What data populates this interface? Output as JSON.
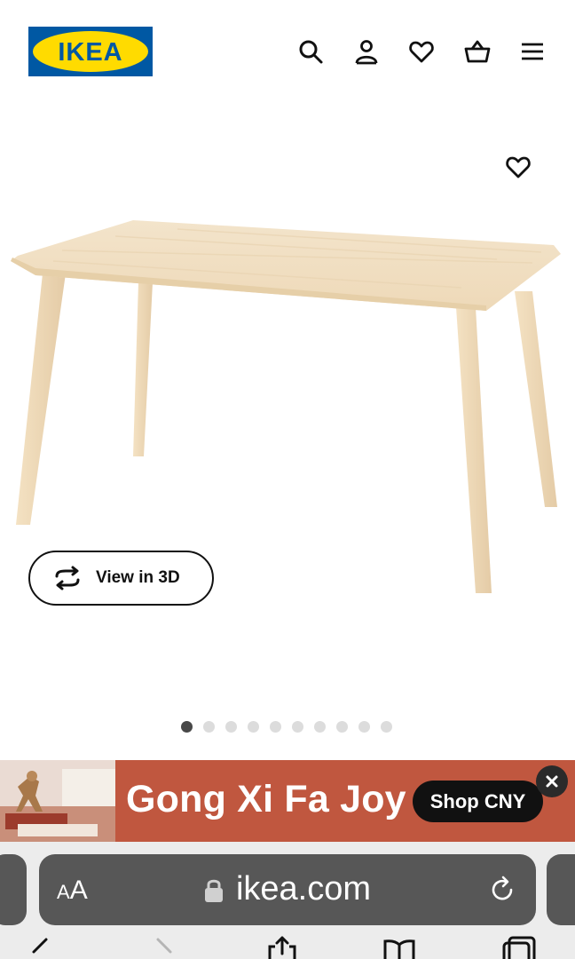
{
  "header": {
    "logo_text": "IKEA",
    "icons": [
      "search-icon",
      "account-icon",
      "favourites-icon",
      "basket-icon",
      "menu-icon"
    ]
  },
  "product": {
    "image": "table-image",
    "favourite_icon": "heart-icon",
    "view3d_label": "View in 3D",
    "carousel": {
      "total": 10,
      "active": 1
    }
  },
  "banner": {
    "title": "Gong Xi Fa Joy",
    "button_label": "Shop CNY",
    "color": "#c0573f"
  },
  "browser": {
    "text_size_button": "AA",
    "url": "ikea.com",
    "toolbar_icons": [
      "back-icon",
      "forward-icon",
      "share-icon",
      "bookmarks-icon",
      "tabs-icon"
    ]
  },
  "colors": {
    "ikea_blue": "#0058a3",
    "ikea_yellow": "#ffdb00",
    "banner": "#c0573f",
    "browser_bar": "#575757"
  }
}
